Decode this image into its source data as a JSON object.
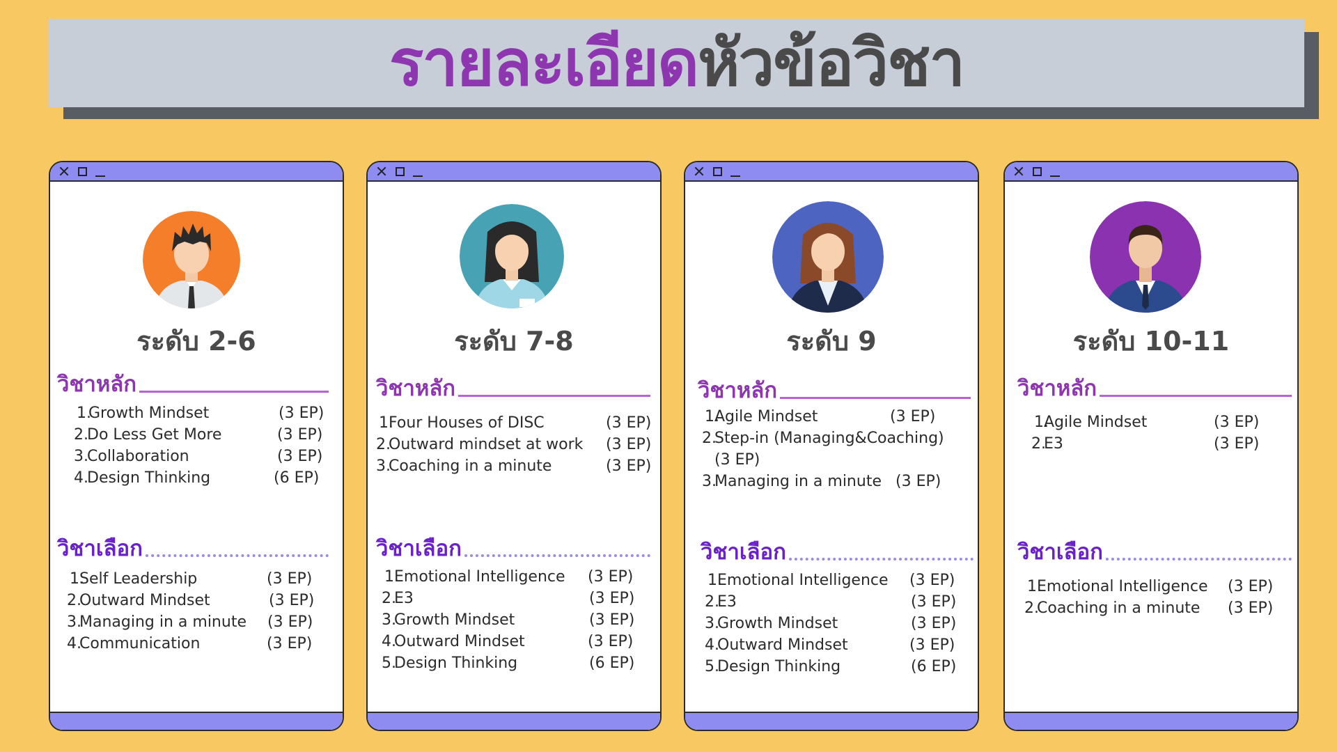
{
  "header": {
    "title_part1": "รายละเอียด",
    "title_part2": "หัวข้อวิชา"
  },
  "colors": {
    "background": "#F8C862",
    "title_purple": "#8E35B0",
    "title_gray": "#4A4A4A",
    "card_bar": "#8E8CF1",
    "elective_purple": "#6B21C8"
  },
  "cards": [
    {
      "level": "ระดับ 2-6",
      "avatar": "young-man-avatar",
      "core_title": "วิชาหลัก",
      "core": [
        {
          "num": "1.",
          "name": "Growth Mindset",
          "ep": "(3 EP)"
        },
        {
          "num": "2.",
          "name": "Do Less Get More",
          "ep": "(3 EP)"
        },
        {
          "num": "3.",
          "name": "Collaboration",
          "ep": "(3 EP)"
        },
        {
          "num": "4.",
          "name": "Design Thinking",
          "ep": "(6 EP)"
        }
      ],
      "elective_title": "วิชาเลือก",
      "elective": [
        {
          "num": "1.",
          "name": "Self Leadership",
          "ep": "(3 EP)"
        },
        {
          "num": "2.",
          "name": "Outward Mindset",
          "ep": "(3 EP)"
        },
        {
          "num": "3.",
          "name": "Managing in a minute",
          "ep": "(3 EP)"
        },
        {
          "num": "4.",
          "name": "Communication",
          "ep": "(3 EP)"
        }
      ]
    },
    {
      "level": "ระดับ 7-8",
      "avatar": "woman-avatar",
      "core_title": "วิชาหลัก",
      "core": [
        {
          "num": "1.",
          "name": "Four Houses of DISC",
          "ep": "(3 EP)"
        },
        {
          "num": "2.",
          "name": "Outward mindset at work",
          "ep": "(3 EP)"
        },
        {
          "num": "3.",
          "name": "Coaching in a minute",
          "ep": "(3 EP)"
        }
      ],
      "elective_title": "วิชาเลือก",
      "elective": [
        {
          "num": "1.",
          "name": "Emotional Intelligence",
          "ep": "(3 EP)"
        },
        {
          "num": "2.",
          "name": "E3",
          "ep": "(3 EP)"
        },
        {
          "num": "3.",
          "name": "Growth Mindset",
          "ep": "(3 EP)"
        },
        {
          "num": "4.",
          "name": "Outward Mindset",
          "ep": "(3 EP)"
        },
        {
          "num": "5.",
          "name": "Design Thinking",
          "ep": "(6 EP)"
        }
      ]
    },
    {
      "level": "ระดับ 9",
      "avatar": "businesswoman-avatar",
      "core_title": "วิชาหลัก",
      "core": [
        {
          "num": "1.",
          "name": "Agile Mindset",
          "ep": "(3 EP)"
        },
        {
          "num": "2.",
          "name": "Step-in (Managing&Coaching)",
          "ep": "(3 EP)"
        },
        {
          "num": "3.",
          "name": "Managing in a minute",
          "ep": "(3 EP)"
        }
      ],
      "elective_title": "วิชาเลือก",
      "elective": [
        {
          "num": "1.",
          "name": "Emotional Intelligence",
          "ep": "(3 EP)"
        },
        {
          "num": "2.",
          "name": "E3",
          "ep": "(3 EP)"
        },
        {
          "num": "3.",
          "name": "Growth Mindset",
          "ep": "(3 EP)"
        },
        {
          "num": "4.",
          "name": "Outward Mindset",
          "ep": "(3 EP)"
        },
        {
          "num": "5.",
          "name": "Design Thinking",
          "ep": "(6 EP)"
        }
      ]
    },
    {
      "level": "ระดับ 10-11",
      "avatar": "businessman-avatar",
      "core_title": "วิชาหลัก",
      "core": [
        {
          "num": "1.",
          "name": "Agile Mindset",
          "ep": "(3 EP)"
        },
        {
          "num": "2.",
          "name": "E3",
          "ep": "(3 EP)"
        }
      ],
      "elective_title": "วิชาเลือก",
      "elective": [
        {
          "num": "1.",
          "name": "Emotional Intelligence",
          "ep": "(3 EP)"
        },
        {
          "num": "2.",
          "name": "Coaching in a minute",
          "ep": "(3 EP)"
        }
      ]
    }
  ]
}
